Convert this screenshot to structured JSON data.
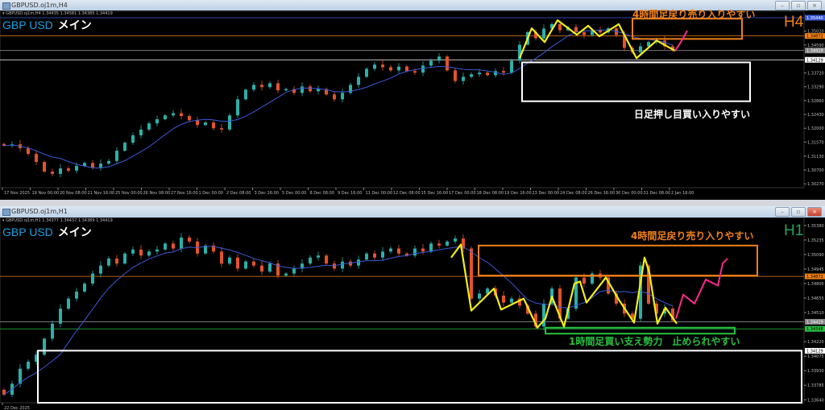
{
  "colors": {
    "up": "#2bb0a8",
    "down": "#e2542a",
    "ma": "#3a5ad8",
    "zigzag": "#f2ee1a",
    "projection": "#ff2a8a",
    "resistance": "#f08018",
    "support": "#28c040",
    "box_white": "#ffffff",
    "symbol": "#1aa0e0"
  },
  "icons": {
    "window": "chart-window-icon",
    "minimize": "minimize-icon",
    "restore": "restore-icon",
    "close": "close-icon"
  },
  "windows": [
    {
      "title": "GBPUSD.oj1m,H4",
      "legend": "▾ GBPUSD.oj1m,H4  1.34435 1.34581 1.34385 1.34419",
      "symbol": "GBP USD",
      "label": "メイン",
      "timeframe": "H4",
      "timeframe_color": "#f08018",
      "annotations": [
        {
          "text": "4時間足戻り売り入りやすい",
          "color": "#f08018"
        },
        {
          "text": "日足押し目買い入りやすい",
          "color": "#ffffff"
        }
      ]
    },
    {
      "title": "GBPUSD.oj1m,H1",
      "legend": "▾ GBPUSD.oj1m,H1  1.34377 1.34437 1.34389 1.34419",
      "symbol": "GBP USD",
      "label": "メイン",
      "timeframe": "H1",
      "timeframe_color": "#2a9d5a",
      "annotations": [
        {
          "text": "4時間足戻り売り入りやすい",
          "color": "#f08018"
        },
        {
          "text": "1時間足買い支え勢力　止められやすい",
          "color": "#28c040"
        }
      ]
    }
  ],
  "chart_data": [
    {
      "type": "candlestick",
      "timeframe": "H4",
      "ylim": [
        1.3015,
        1.3564
      ],
      "y_ticks": [
        1.3502,
        1.3459,
        1.3372,
        1.3329,
        1.3286,
        1.3243,
        1.32,
        1.3157,
        1.3113,
        1.307,
        1.3027
      ],
      "x_ticks": [
        "17 Nov 2025",
        "19 Nov 00:00",
        "20 Nov 08:00",
        "21 Nov 16:00",
        "25 Nov 00:00",
        "26 Nov 08:00",
        "27 Nov 16:00",
        "1 Dec 00:00",
        "2 Dec 08:00",
        "3 Dec 16:00",
        "5 Dec 00:00",
        "8 Dec 08:00",
        "9 Dec 16:00",
        "11 Dec 00:00",
        "12 Dec 08:00",
        "15 Dec 16:00",
        "17 Dec 00:00",
        "18 Dec 08:00",
        "19 Dec 16:00",
        "23 Dec 00:00",
        "24 Dec 08:00",
        "26 Dec 16:00",
        "30 Dec 00:00",
        "31 Dec 08:00",
        "2 Jan 16:00"
      ],
      "price_lines": [
        {
          "price": 1.3544,
          "label": "1.35440",
          "color": "#3a5ad8"
        },
        {
          "price": 1.34872,
          "label": "1.34872",
          "color": "#f08018"
        },
        {
          "price": 1.34419,
          "label": "1.34419",
          "color": "#888888"
        },
        {
          "price": 1.34129,
          "label": "1.34129",
          "color": "#ffffff"
        }
      ],
      "closes": [
        1.3146,
        1.315,
        1.3138,
        1.312,
        1.3095,
        1.3065,
        1.3058,
        1.3075,
        1.3068,
        1.3083,
        1.3092,
        1.3078,
        1.309,
        1.3098,
        1.313,
        1.3155,
        1.3178,
        1.3196,
        1.3215,
        1.3228,
        1.324,
        1.3247,
        1.3238,
        1.3225,
        1.321,
        1.3218,
        1.32,
        1.3196,
        1.324,
        1.329,
        1.332,
        1.3335,
        1.3328,
        1.334,
        1.3318,
        1.3322,
        1.331,
        1.333,
        1.3315,
        1.3322,
        1.3305,
        1.329,
        1.331,
        1.3335,
        1.336,
        1.3385,
        1.3398,
        1.339,
        1.338,
        1.3392,
        1.3378,
        1.3373,
        1.3395,
        1.341,
        1.3423,
        1.338,
        1.3347,
        1.336,
        1.3368,
        1.3373,
        1.3365,
        1.3378,
        1.3373,
        1.341,
        1.346,
        1.3499,
        1.348,
        1.351,
        1.3524,
        1.3505,
        1.3515,
        1.3499,
        1.349,
        1.3505,
        1.3498,
        1.3511,
        1.349,
        1.345,
        1.3436,
        1.3455,
        1.3468,
        1.3473,
        1.3455,
        1.3443
      ],
      "zigzag": [
        [
          64,
          1.3418
        ],
        [
          65.5,
          1.3511
        ],
        [
          67.1,
          1.3468
        ],
        [
          68.7,
          1.3536
        ],
        [
          71.1,
          1.3491
        ],
        [
          72.5,
          1.3519
        ],
        [
          73.9,
          1.3486
        ],
        [
          76.3,
          1.3524
        ],
        [
          78.5,
          1.3418
        ],
        [
          81,
          1.3473
        ],
        [
          83.3,
          1.3441
        ]
      ],
      "projection": [
        [
          83.3,
          1.3441
        ],
        [
          84,
          1.3468
        ],
        [
          84.8,
          1.3504
        ]
      ],
      "zones": [
        {
          "kind": "resistance",
          "from_bar": 78,
          "to_bar": 91.6,
          "high": 1.3541,
          "low": 1.3478,
          "color": "#f08018"
        },
        {
          "kind": "daily-support",
          "from_bar": 64.3,
          "to_bar": 92.6,
          "high": 1.3405,
          "low": 1.3284,
          "color": "#ffffff"
        }
      ]
    },
    {
      "type": "candlestick",
      "timeframe": "H1",
      "ylim": [
        1.3361,
        1.3546
      ],
      "y_ticks": [
        1.3538,
        1.35235,
        1.3509,
        1.34945,
        1.348,
        1.34655,
        1.3451,
        1.3422,
        1.34075,
        1.3393,
        1.33785,
        1.3364
      ],
      "x_ticks": [
        "22 Dec 2025"
      ],
      "price_lines": [
        {
          "price": 1.34872,
          "label": "1.34872",
          "color": "#f08018"
        },
        {
          "price": 1.34419,
          "label": "1.34419",
          "color": "#888888"
        },
        {
          "price": 1.34348,
          "label": "1.34348",
          "color": "#28c040"
        },
        {
          "price": 1.34129,
          "label": "1.34129",
          "color": "#ffffff",
          "noline": true
        }
      ],
      "closes": [
        1.3369,
        1.338,
        1.3395,
        1.3402,
        1.3409,
        1.3425,
        1.344,
        1.3455,
        1.3465,
        1.3472,
        1.348,
        1.349,
        1.3498,
        1.3505,
        1.35,
        1.351,
        1.3514,
        1.3508,
        1.3512,
        1.3514,
        1.352,
        1.3515,
        1.3526,
        1.3522,
        1.351,
        1.3518,
        1.3512,
        1.35,
        1.3506,
        1.3495,
        1.3502,
        1.3498,
        1.3492,
        1.35,
        1.3488,
        1.349,
        1.3495,
        1.35,
        1.3506,
        1.3508,
        1.35,
        1.3495,
        1.3502,
        1.3498,
        1.3504,
        1.351,
        1.3506,
        1.3512,
        1.3515,
        1.351,
        1.3508,
        1.3515,
        1.3512,
        1.352,
        1.3518,
        1.3522,
        1.3525,
        1.3515,
        1.3465,
        1.347,
        1.3475,
        1.3468,
        1.3461,
        1.3465,
        1.3458,
        1.345,
        1.3437,
        1.346,
        1.3475,
        1.3445,
        1.3455,
        1.3486,
        1.348,
        1.349,
        1.3486,
        1.347,
        1.346,
        1.345,
        1.3445,
        1.3498,
        1.346,
        1.345,
        1.3455,
        1.3443
      ],
      "zigzag": [
        [
          55.5,
          1.3506
        ],
        [
          56.7,
          1.3519
        ],
        [
          58,
          1.3453
        ],
        [
          60.8,
          1.3475
        ],
        [
          61.7,
          1.3454
        ],
        [
          64.5,
          1.3465
        ],
        [
          66.2,
          1.3436
        ],
        [
          67.2,
          1.3445
        ],
        [
          68,
          1.3467
        ],
        [
          69.5,
          1.3437
        ],
        [
          70.8,
          1.348
        ],
        [
          71.5,
          1.3482
        ],
        [
          72.3,
          1.3461
        ],
        [
          74.7,
          1.3486
        ],
        [
          76.3,
          1.3464
        ],
        [
          78.2,
          1.3441
        ],
        [
          79.5,
          1.3506
        ],
        [
          80.1,
          1.3491
        ],
        [
          81.1,
          1.344
        ],
        [
          82.1,
          1.3456
        ],
        [
          83.5,
          1.344
        ]
      ],
      "projection": [
        [
          83.4,
          1.3445
        ],
        [
          84.3,
          1.3469
        ],
        [
          85.7,
          1.346
        ],
        [
          87.1,
          1.3484
        ],
        [
          88.6,
          1.3478
        ],
        [
          89.2,
          1.35
        ],
        [
          89.8,
          1.3505
        ]
      ],
      "zones": [
        {
          "kind": "resistance",
          "from_bar": 58.9,
          "to_bar": 93.5,
          "high": 1.3518,
          "low": 1.3488,
          "color": "#f08018"
        },
        {
          "kind": "h1-support",
          "from_bar": 67.2,
          "to_bar": 90.7,
          "high": 1.3436,
          "low": 1.343,
          "color": "#28c040"
        },
        {
          "kind": "daily-support",
          "from_bar": 4.2,
          "to_bar": 99,
          "high": 1.3413,
          "low": 1.3361,
          "color": "#ffffff"
        }
      ]
    }
  ]
}
